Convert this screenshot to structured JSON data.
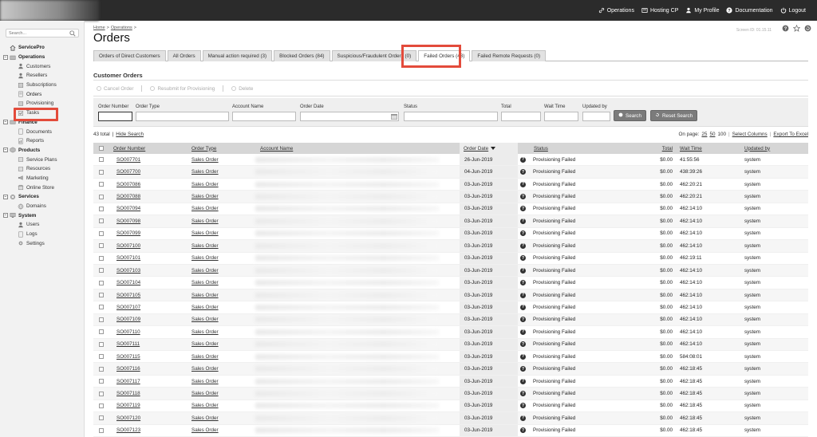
{
  "topnav": [
    {
      "label": "Operations",
      "icon": "link-icon"
    },
    {
      "label": "Hosting CP",
      "icon": "hosting-icon"
    },
    {
      "label": "My Profile",
      "icon": "profile-icon"
    },
    {
      "label": "Documentation",
      "icon": "help-icon"
    },
    {
      "label": "Logout",
      "icon": "power-icon"
    }
  ],
  "sidebar": {
    "search_placeholder": "Search...",
    "root": "ServicePro",
    "sections": [
      {
        "label": "Operations",
        "items": [
          "Customers",
          "Resellers",
          "Subscriptions",
          "Orders",
          "Provisioning",
          "Tasks"
        ]
      },
      {
        "label": "Finance",
        "items": [
          "Documents",
          "Reports"
        ]
      },
      {
        "label": "Products",
        "items": [
          "Service Plans",
          "Resources",
          "Marketing",
          "Online Store"
        ]
      },
      {
        "label": "Services",
        "items": [
          "Domains"
        ]
      },
      {
        "label": "System",
        "items": [
          "Users",
          "Logs",
          "Settings"
        ]
      }
    ],
    "active_item": "Orders"
  },
  "breadcrumb": [
    "Home",
    "Operations"
  ],
  "page_title": "Orders",
  "screen_id": "Screen ID: 01.15.11",
  "tabs": [
    "Orders of Direct Customers",
    "All Orders",
    "Manual action required (3)",
    "Blocked Orders (84)",
    "Suspicious/Fraudulent Orders (0)",
    "Failed Orders (43)",
    "Failed Remote Requests (0)"
  ],
  "active_tab": "Failed Orders (43)",
  "section_title": "Customer Orders",
  "actions": [
    "Cancel Order",
    "Resubmit for Provisioning",
    "Delete"
  ],
  "filters": {
    "order_number": "Order Number",
    "order_type": "Order Type",
    "account_name": "Account Name",
    "order_date": "Order Date",
    "status": "Status",
    "total": "Total",
    "wait_time": "Wait Time",
    "updated_by": "Updated by",
    "search_button": "Search",
    "reset_button": "Reset Search"
  },
  "totals": {
    "count_text": "43 total",
    "separator": "|",
    "hide_search": "Hide Search"
  },
  "pager": {
    "on_page_label": "On page:",
    "sizes": [
      "25",
      "50",
      "100"
    ],
    "select_columns": "Select Columns",
    "export": "Export To Excel"
  },
  "columns": [
    "Order Number",
    "Order Type",
    "Account Name",
    "Order Date",
    "Status",
    "Total",
    "Wait Time",
    "Updated by"
  ],
  "rows": [
    {
      "order": "SO007701",
      "type": "Sales Order",
      "date": "26-Jun-2019",
      "status": "Provisioning Failed",
      "total": "$0.00",
      "wait": "41:55:56",
      "by": "system"
    },
    {
      "order": "SO007700",
      "type": "Sales Order",
      "date": "04-Jun-2019",
      "status": "Provisioning Failed",
      "total": "$0.00",
      "wait": "438:39:26",
      "by": "system"
    },
    {
      "order": "SO007086",
      "type": "Sales Order",
      "date": "03-Jun-2019",
      "status": "Provisioning Failed",
      "total": "$0.00",
      "wait": "462:20:21",
      "by": "system"
    },
    {
      "order": "SO007088",
      "type": "Sales Order",
      "date": "03-Jun-2019",
      "status": "Provisioning Failed",
      "total": "$0.00",
      "wait": "462:20:21",
      "by": "system"
    },
    {
      "order": "SO007094",
      "type": "Sales Order",
      "date": "03-Jun-2019",
      "status": "Provisioning Failed",
      "total": "$0.00",
      "wait": "462:14:10",
      "by": "system"
    },
    {
      "order": "SO007098",
      "type": "Sales Order",
      "date": "03-Jun-2019",
      "status": "Provisioning Failed",
      "total": "$0.00",
      "wait": "462:14:10",
      "by": "system"
    },
    {
      "order": "SO007099",
      "type": "Sales Order",
      "date": "03-Jun-2019",
      "status": "Provisioning Failed",
      "total": "$0.00",
      "wait": "462:14:10",
      "by": "system"
    },
    {
      "order": "SO007100",
      "type": "Sales Order",
      "date": "03-Jun-2019",
      "status": "Provisioning Failed",
      "total": "$0.00",
      "wait": "462:14:10",
      "by": "system"
    },
    {
      "order": "SO007101",
      "type": "Sales Order",
      "date": "03-Jun-2019",
      "status": "Provisioning Failed",
      "total": "$0.00",
      "wait": "462:19:11",
      "by": "system"
    },
    {
      "order": "SO007103",
      "type": "Sales Order",
      "date": "03-Jun-2019",
      "status": "Provisioning Failed",
      "total": "$0.00",
      "wait": "462:14:10",
      "by": "system"
    },
    {
      "order": "SO007104",
      "type": "Sales Order",
      "date": "03-Jun-2019",
      "status": "Provisioning Failed",
      "total": "$0.00",
      "wait": "462:14:10",
      "by": "system"
    },
    {
      "order": "SO007105",
      "type": "Sales Order",
      "date": "03-Jun-2019",
      "status": "Provisioning Failed",
      "total": "$0.00",
      "wait": "462:14:10",
      "by": "system"
    },
    {
      "order": "SO007107",
      "type": "Sales Order",
      "date": "03-Jun-2019",
      "status": "Provisioning Failed",
      "total": "$0.00",
      "wait": "462:14:10",
      "by": "system"
    },
    {
      "order": "SO007109",
      "type": "Sales Order",
      "date": "03-Jun-2019",
      "status": "Provisioning Failed",
      "total": "$0.00",
      "wait": "462:14:10",
      "by": "system"
    },
    {
      "order": "SO007110",
      "type": "Sales Order",
      "date": "03-Jun-2019",
      "status": "Provisioning Failed",
      "total": "$0.00",
      "wait": "462:14:10",
      "by": "system"
    },
    {
      "order": "SO007111",
      "type": "Sales Order",
      "date": "03-Jun-2019",
      "status": "Provisioning Failed",
      "total": "$0.00",
      "wait": "462:14:10",
      "by": "system"
    },
    {
      "order": "SO007115",
      "type": "Sales Order",
      "date": "03-Jun-2019",
      "status": "Provisioning Failed",
      "total": "$0.00",
      "wait": "584:08:01",
      "by": "system"
    },
    {
      "order": "SO007116",
      "type": "Sales Order",
      "date": "03-Jun-2019",
      "status": "Provisioning Failed",
      "total": "$0.00",
      "wait": "462:18:45",
      "by": "system"
    },
    {
      "order": "SO007117",
      "type": "Sales Order",
      "date": "03-Jun-2019",
      "status": "Provisioning Failed",
      "total": "$0.00",
      "wait": "462:18:45",
      "by": "system"
    },
    {
      "order": "SO007118",
      "type": "Sales Order",
      "date": "03-Jun-2019",
      "status": "Provisioning Failed",
      "total": "$0.00",
      "wait": "462:18:45",
      "by": "system"
    },
    {
      "order": "SO007119",
      "type": "Sales Order",
      "date": "03-Jun-2019",
      "status": "Provisioning Failed",
      "total": "$0.00",
      "wait": "462:18:45",
      "by": "system"
    },
    {
      "order": "SO007120",
      "type": "Sales Order",
      "date": "03-Jun-2019",
      "status": "Provisioning Failed",
      "total": "$0.00",
      "wait": "462:18:45",
      "by": "system"
    },
    {
      "order": "SO007123",
      "type": "Sales Order",
      "date": "03-Jun-2019",
      "status": "Provisioning Failed",
      "total": "$0.00",
      "wait": "462:18:45",
      "by": "system"
    }
  ],
  "colors": {
    "highlight": "#e34b3b",
    "topbar": "#2b2b2b",
    "header_row": "#d6d6d6"
  }
}
